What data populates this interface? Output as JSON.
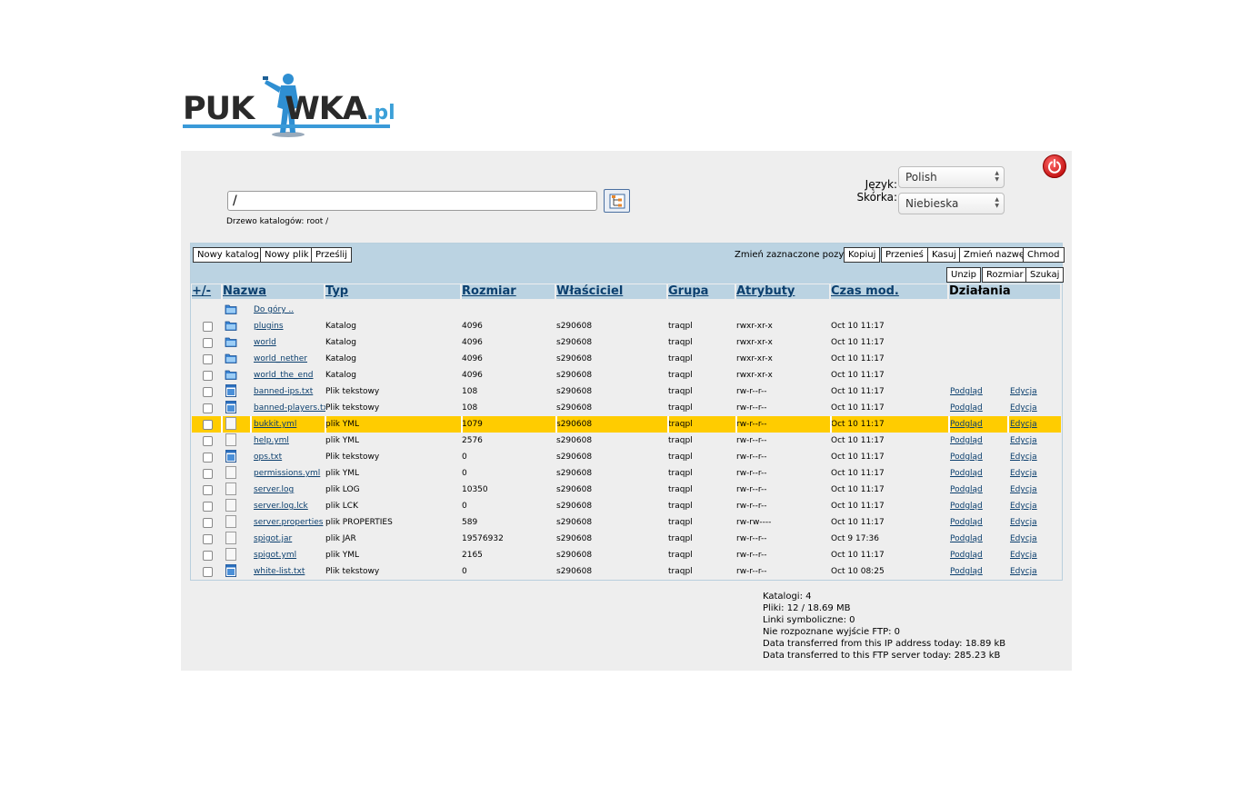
{
  "logo": {
    "text_before": "PUK",
    "text_after": "WKA",
    "tld": ".pl"
  },
  "header": {
    "path_value": "/",
    "tree_label": "Drzewo katalogów:",
    "tree_root_link": "root",
    "tree_suffix": "/",
    "language_label": "Język:",
    "language_value": "Polish",
    "skin_label": "Skórka:",
    "skin_value": "Niebieska"
  },
  "toolbar": {
    "new_dir": "Nowy katalog",
    "new_file": "Nowy plik",
    "upload": "Prześlij",
    "change_selected_label": "Zmień zaznaczone pozycje:",
    "copy": "Kopiuj",
    "move": "Przenieś",
    "delete": "Kasuj",
    "rename": "Zmień nazwę",
    "chmod": "Chmod",
    "unzip": "Unzip",
    "size": "Rozmiar",
    "search": "Szukaj"
  },
  "columns": {
    "toggle": "+/-",
    "name": "Nazwa",
    "type": "Typ",
    "size": "Rozmiar",
    "owner": "Właściciel",
    "group": "Grupa",
    "attrs": "Atrybuty",
    "mtime": "Czas mod.",
    "actions": "Działania"
  },
  "up_link": "Do góry ..",
  "action_labels": {
    "view": "Podgląd",
    "edit": "Edycja"
  },
  "files": [
    {
      "name": "plugins",
      "type": "Katalog",
      "size": "4096",
      "owner": "s290608",
      "group": "traqpl",
      "attrs": "rwxr-xr-x",
      "mtime": "Oct 10 11:17",
      "icon": "folder-icon",
      "actions": false,
      "selected": false
    },
    {
      "name": "world",
      "type": "Katalog",
      "size": "4096",
      "owner": "s290608",
      "group": "traqpl",
      "attrs": "rwxr-xr-x",
      "mtime": "Oct 10 11:17",
      "icon": "folder-icon",
      "actions": false,
      "selected": false
    },
    {
      "name": "world_nether",
      "type": "Katalog",
      "size": "4096",
      "owner": "s290608",
      "group": "traqpl",
      "attrs": "rwxr-xr-x",
      "mtime": "Oct 10 11:17",
      "icon": "folder-icon",
      "actions": false,
      "selected": false
    },
    {
      "name": "world_the_end",
      "type": "Katalog",
      "size": "4096",
      "owner": "s290608",
      "group": "traqpl",
      "attrs": "rwxr-xr-x",
      "mtime": "Oct 10 11:17",
      "icon": "folder-icon",
      "actions": false,
      "selected": false
    },
    {
      "name": "banned-ips.txt",
      "type": "Plik tekstowy",
      "size": "108",
      "owner": "s290608",
      "group": "traqpl",
      "attrs": "rw-r--r--",
      "mtime": "Oct 10 11:17",
      "icon": "text-file-icon",
      "actions": true,
      "selected": false
    },
    {
      "name": "banned-players.txt",
      "type": "Plik tekstowy",
      "size": "108",
      "owner": "s290608",
      "group": "traqpl",
      "attrs": "rw-r--r--",
      "mtime": "Oct 10 11:17",
      "icon": "text-file-icon",
      "actions": true,
      "selected": false
    },
    {
      "name": "bukkit.yml",
      "type": "plik YML",
      "size": "1079",
      "owner": "s290608",
      "group": "traqpl",
      "attrs": "rw-r--r--",
      "mtime": "Oct 10 11:17",
      "icon": "file-icon",
      "actions": true,
      "selected": true
    },
    {
      "name": "help.yml",
      "type": "plik YML",
      "size": "2576",
      "owner": "s290608",
      "group": "traqpl",
      "attrs": "rw-r--r--",
      "mtime": "Oct 10 11:17",
      "icon": "file-icon",
      "actions": true,
      "selected": false
    },
    {
      "name": "ops.txt",
      "type": "Plik tekstowy",
      "size": "0",
      "owner": "s290608",
      "group": "traqpl",
      "attrs": "rw-r--r--",
      "mtime": "Oct 10 11:17",
      "icon": "text-file-icon",
      "actions": true,
      "selected": false
    },
    {
      "name": "permissions.yml",
      "type": "plik YML",
      "size": "0",
      "owner": "s290608",
      "group": "traqpl",
      "attrs": "rw-r--r--",
      "mtime": "Oct 10 11:17",
      "icon": "file-icon",
      "actions": true,
      "selected": false
    },
    {
      "name": "server.log",
      "type": "plik LOG",
      "size": "10350",
      "owner": "s290608",
      "group": "traqpl",
      "attrs": "rw-r--r--",
      "mtime": "Oct 10 11:17",
      "icon": "file-icon",
      "actions": true,
      "selected": false
    },
    {
      "name": "server.log.lck",
      "type": "plik LCK",
      "size": "0",
      "owner": "s290608",
      "group": "traqpl",
      "attrs": "rw-r--r--",
      "mtime": "Oct 10 11:17",
      "icon": "file-icon",
      "actions": true,
      "selected": false
    },
    {
      "name": "server.properties",
      "type": "plik PROPERTIES",
      "size": "589",
      "owner": "s290608",
      "group": "traqpl",
      "attrs": "rw-rw----",
      "mtime": "Oct 10 11:17",
      "icon": "file-icon",
      "actions": true,
      "selected": false
    },
    {
      "name": "spigot.jar",
      "type": "plik JAR",
      "size": "19576932",
      "owner": "s290608",
      "group": "traqpl",
      "attrs": "rw-r--r--",
      "mtime": "Oct 9 17:36",
      "icon": "file-icon",
      "actions": true,
      "selected": false
    },
    {
      "name": "spigot.yml",
      "type": "plik YML",
      "size": "2165",
      "owner": "s290608",
      "group": "traqpl",
      "attrs": "rw-r--r--",
      "mtime": "Oct 10 11:17",
      "icon": "file-icon",
      "actions": true,
      "selected": false
    },
    {
      "name": "white-list.txt",
      "type": "Plik tekstowy",
      "size": "0",
      "owner": "s290608",
      "group": "traqpl",
      "attrs": "rw-r--r--",
      "mtime": "Oct 10 08:25",
      "icon": "text-file-icon",
      "actions": true,
      "selected": false
    }
  ],
  "summary": [
    "Katalogi: 4",
    "Pliki: 12 / 18.69 MB",
    "Linki symboliczne: 0",
    "Nie rozpoznane wyjście FTP: 0",
    "Data transferred from this IP address today: 18.89 kB",
    "Data transferred to this FTP server today: 285.23 kB"
  ]
}
